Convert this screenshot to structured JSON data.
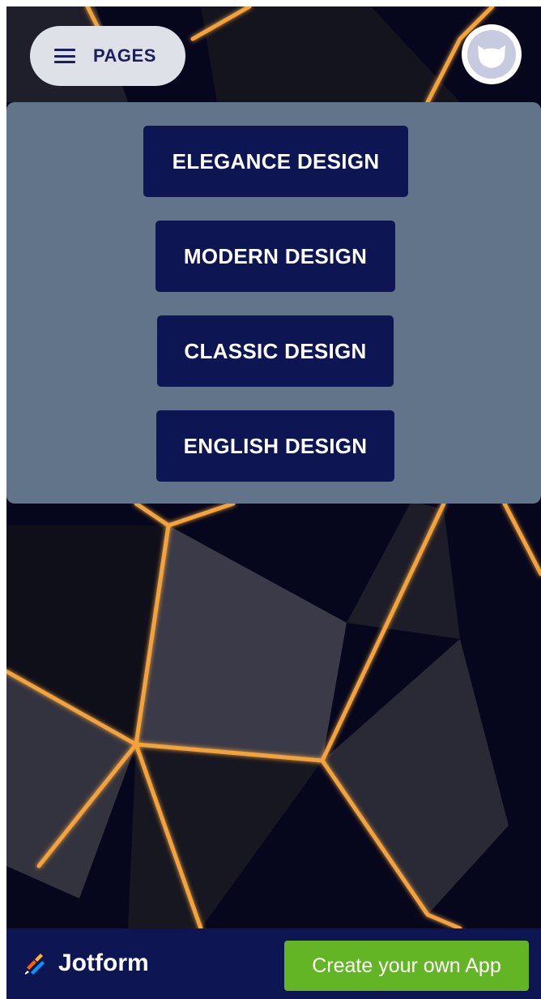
{
  "header": {
    "pages_label": "PAGES",
    "menu_icon": "hamburger-icon",
    "avatar_icon": "avatar-icon"
  },
  "menu": {
    "items": [
      {
        "label": "ELEGANCE DESIGN"
      },
      {
        "label": "MODERN DESIGN"
      },
      {
        "label": "CLASSIC DESIGN"
      },
      {
        "label": "ENGLISH DESIGN"
      }
    ]
  },
  "footer": {
    "logo_text": "Jotform",
    "cta_label": "Create your own App"
  },
  "colors": {
    "navy": "#0d1552",
    "panel": "#627489",
    "cta_green": "#64b525",
    "gold_line": "#f2a33c"
  }
}
